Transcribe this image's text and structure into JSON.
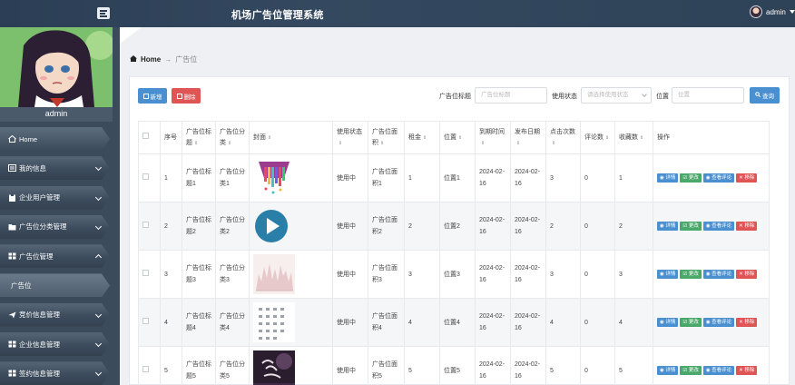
{
  "header": {
    "title": "机场广告位管理系统",
    "user": "admin"
  },
  "sidebar": {
    "username": "admin",
    "items": [
      {
        "label": "Home",
        "icon": "home-icon"
      },
      {
        "label": "我的信息",
        "icon": "id-card-icon"
      },
      {
        "label": "企业用户管理",
        "icon": "clipboard-icon"
      },
      {
        "label": "广告位分类管理",
        "icon": "folder-icon"
      },
      {
        "label": "广告位管理",
        "icon": "grid-icon"
      },
      {
        "label": "广告位",
        "icon": ""
      },
      {
        "label": "竞价信息管理",
        "icon": "send-icon"
      },
      {
        "label": "企业信息管理",
        "icon": "grid-icon"
      },
      {
        "label": "签约信息管理",
        "icon": "grid-icon"
      }
    ]
  },
  "breadcrumb": {
    "home": "Home",
    "separator": "→",
    "current": "广告位"
  },
  "toolbar": {
    "add_label": "新增",
    "delete_label": "删除",
    "title_label": "广告位标题",
    "title_placeholder": "广告位标题",
    "status_label": "使用状态",
    "status_placeholder": "请选择使用状态",
    "position_label": "位置",
    "position_placeholder": "位置",
    "search_label": "查询"
  },
  "table": {
    "columns": [
      "序号",
      "广告位标题",
      "广告位分类",
      "封面",
      "使用状态",
      "广告位面积",
      "租金",
      "位置",
      "到期时间",
      "发布日期",
      "点击次数",
      "评论数",
      "收藏数",
      "操作"
    ],
    "rows": [
      {
        "no": "1",
        "title": "广告位标题1",
        "category": "广告位分类1",
        "cover": "colorful-strips",
        "status": "使用中",
        "area": "广告位面积1",
        "rent": "1",
        "position": "位置1",
        "expire": "2024-02-16",
        "publish": "2024-02-16",
        "clicks": "3",
        "comments": "0",
        "favorites": "1"
      },
      {
        "no": "2",
        "title": "广告位标题2",
        "category": "广告位分类2",
        "cover": "play-button",
        "status": "使用中",
        "area": "广告位面积2",
        "rent": "2",
        "position": "位置2",
        "expire": "2024-02-16",
        "publish": "2024-02-16",
        "clicks": "2",
        "comments": "0",
        "favorites": "2"
      },
      {
        "no": "3",
        "title": "广告位标题3",
        "category": "广告位分类3",
        "cover": "pink-chart",
        "status": "使用中",
        "area": "广告位面积3",
        "rent": "3",
        "position": "位置3",
        "expire": "2024-02-16",
        "publish": "2024-02-16",
        "clicks": "3",
        "comments": "0",
        "favorites": "3"
      },
      {
        "no": "4",
        "title": "广告位标题4",
        "category": "广告位分类4",
        "cover": "icon-grid",
        "status": "使用中",
        "area": "广告位面积4",
        "rent": "4",
        "position": "位置4",
        "expire": "2024-02-16",
        "publish": "2024-02-16",
        "clicks": "4",
        "comments": "0",
        "favorites": "4"
      },
      {
        "no": "5",
        "title": "广告位标题5",
        "category": "广告位分类5",
        "cover": "dark-poster",
        "status": "使用中",
        "area": "广告位面积5",
        "rent": "5",
        "position": "位置5",
        "expire": "2024-02-16",
        "publish": "2024-02-16",
        "clicks": "5",
        "comments": "0",
        "favorites": "5"
      }
    ],
    "actions": {
      "detail": "详情",
      "edit": "更改",
      "comments": "查看评论",
      "remove": "移除"
    }
  },
  "colors": {
    "topbar": "#2b3e55",
    "sidebar": "#3c4b5c",
    "primary": "#4a8fd0",
    "success": "#4aa86a",
    "danger": "#df5454"
  }
}
